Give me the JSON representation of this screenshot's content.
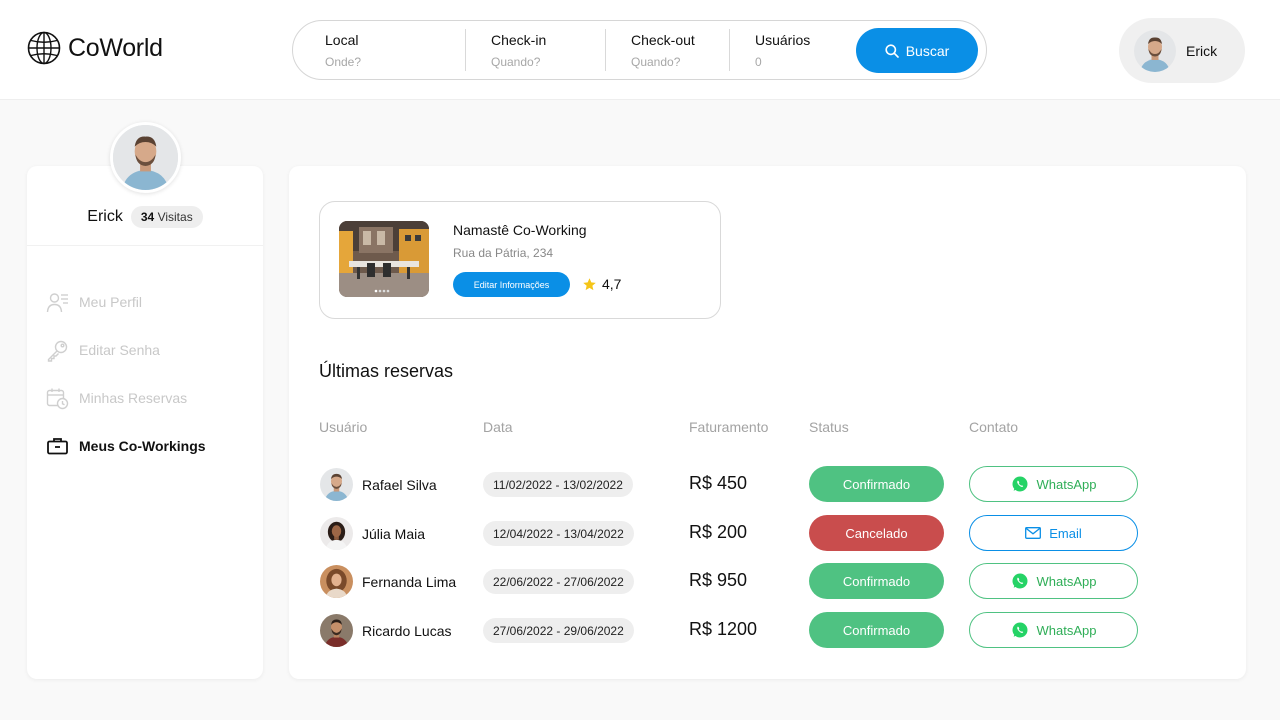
{
  "brand": {
    "name": "CoWorld"
  },
  "colors": {
    "accent": "#0a8fe6",
    "confirmed": "#4fc282",
    "cancelled": "#c94d4d",
    "whatsapp": "#25d366"
  },
  "search": {
    "fields": [
      {
        "label": "Local",
        "placeholder": "Onde?"
      },
      {
        "label": "Check-in",
        "placeholder": "Quando?"
      },
      {
        "label": "Check-out",
        "placeholder": "Quando?"
      },
      {
        "label": "Usuários",
        "placeholder": "0"
      }
    ],
    "button_label": "Buscar",
    "button_icon": "search-icon"
  },
  "user": {
    "name": "Erick"
  },
  "profile": {
    "name": "Erick",
    "visits_count": "34",
    "visits_label": "Visitas"
  },
  "sidebar": {
    "items": [
      {
        "label": "Meu Perfil",
        "icon": "user-profile-icon",
        "active": false
      },
      {
        "label": "Editar Senha",
        "icon": "key-icon",
        "active": false
      },
      {
        "label": "Minhas Reservas",
        "icon": "calendar-clock-icon",
        "active": false
      },
      {
        "label": "Meus Co-Workings",
        "icon": "briefcase-icon",
        "active": true
      }
    ]
  },
  "coworking": {
    "name": "Namastê Co-Working",
    "address": "Rua da Pátria, 234",
    "edit_label": "Editar Informações",
    "rating": "4,7"
  },
  "reservations": {
    "title": "Últimas reservas",
    "columns": [
      "Usuário",
      "Data",
      "Faturamento",
      "Status",
      "Contato"
    ],
    "rows": [
      {
        "user": "Rafael Silva",
        "date": "11/02/2022 - 13/02/2022",
        "amount": "R$ 450",
        "status": "Confirmado",
        "contact": "WhatsApp"
      },
      {
        "user": "Júlia Maia",
        "date": "12/04/2022 - 13/04/2022",
        "amount": "R$ 200",
        "status": "Cancelado",
        "contact": "Email"
      },
      {
        "user": "Fernanda Lima",
        "date": "22/06/2022 - 27/06/2022",
        "amount": "R$ 950",
        "status": "Confirmado",
        "contact": "WhatsApp"
      },
      {
        "user": "Ricardo Lucas",
        "date": "27/06/2022 - 29/06/2022",
        "amount": "R$ 1200",
        "status": "Confirmado",
        "contact": "WhatsApp"
      }
    ]
  }
}
